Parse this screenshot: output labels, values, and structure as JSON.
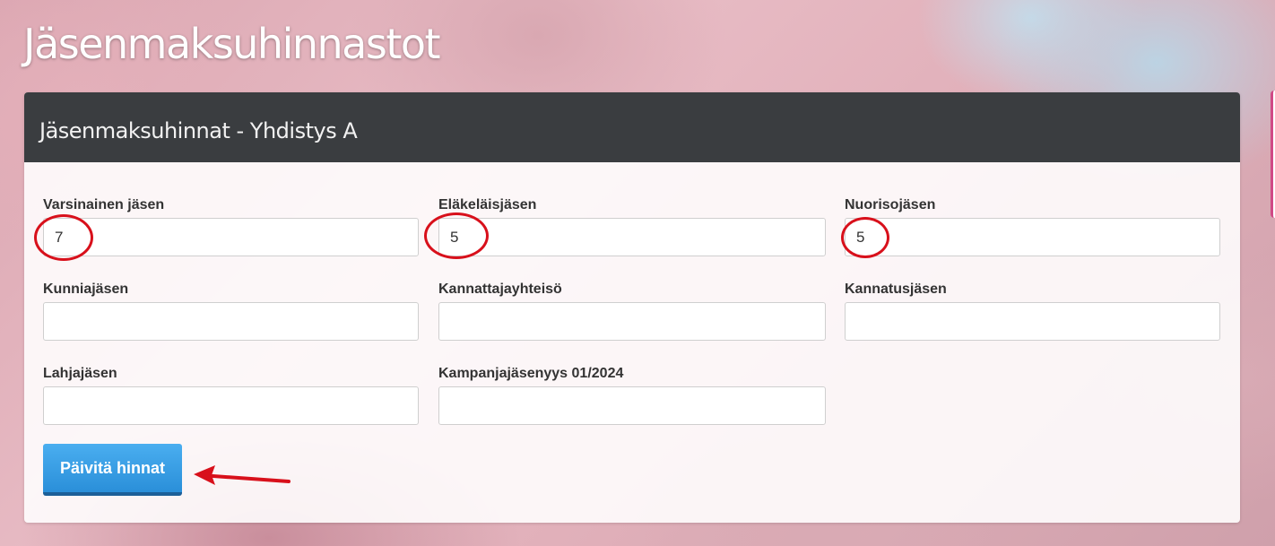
{
  "page": {
    "title": "Jäsenmaksuhinnastot"
  },
  "panel": {
    "title": "Jäsenmaksuhinnat - Yhdistys A"
  },
  "fields": [
    {
      "label": "Varsinainen jäsen",
      "value": "7"
    },
    {
      "label": "Eläkeläisjäsen",
      "value": "5"
    },
    {
      "label": "Nuorisojäsen",
      "value": "5"
    },
    {
      "label": "Kunniajäsen",
      "value": ""
    },
    {
      "label": "Kannattajayhteisö",
      "value": ""
    },
    {
      "label": "Kannatusjäsen",
      "value": ""
    },
    {
      "label": "Lahjajäsen",
      "value": ""
    },
    {
      "label": "Kampanjajäsenyys 01/2024",
      "value": ""
    }
  ],
  "submit_button": {
    "label": "Päivitä hinnat"
  },
  "colors": {
    "panel_header": "#3a3d40",
    "button": "#2a8fd9",
    "annotation": "#d8101b"
  }
}
